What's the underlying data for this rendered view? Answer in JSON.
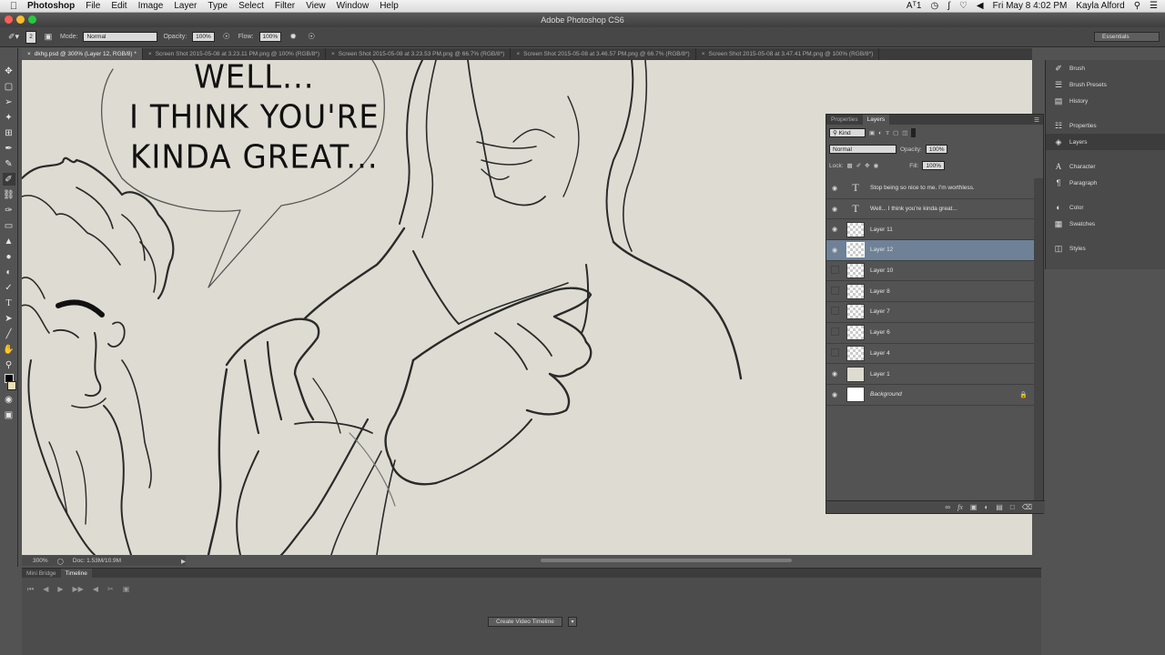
{
  "menubar": {
    "app": "Photoshop",
    "menus": [
      "File",
      "Edit",
      "Image",
      "Layer",
      "Type",
      "Select",
      "Filter",
      "View",
      "Window",
      "Help"
    ],
    "status_num": "1",
    "datetime": "Fri May 8  4:02 PM",
    "user": "Kayla Alford"
  },
  "window": {
    "title": "Adobe Photoshop CS6"
  },
  "options": {
    "brush_size": "2",
    "mode_label": "Mode:",
    "mode_value": "Normal",
    "opacity_label": "Opacity:",
    "opacity_value": "100%",
    "flow_label": "Flow:",
    "flow_value": "100%",
    "workspace": "Essentials"
  },
  "tabs": [
    {
      "label": "dkhg.psd @ 300% (Layer 12, RGB/8) *"
    },
    {
      "label": "Screen Shot 2015-05-08 at 3.23.11 PM.png @ 100% (RGB/8*)"
    },
    {
      "label": "Screen Shot 2015-05-08 at 3.23.53 PM.png @ 66.7% (RGB/8*)"
    },
    {
      "label": "Screen Shot 2015-05-08 at 3.46.57 PM.png @ 66.7% (RGB/8*)"
    },
    {
      "label": "Screen Shot 2015-05-08 at 3.47.41 PM.png @ 100% (RGB/8*)"
    }
  ],
  "canvas": {
    "speech": [
      "WELL...",
      "I THINK YOU'RE",
      "KINDA GREAT..."
    ]
  },
  "status": {
    "zoom": "300%",
    "doc": "Doc: 1.53M/10.9M"
  },
  "timeline": {
    "tabs": [
      "Mini Bridge",
      "Timeline"
    ],
    "create_button": "Create Video Timeline"
  },
  "dock": {
    "items": [
      {
        "label": "Brush",
        "icon": "brush-icon"
      },
      {
        "label": "Brush Presets",
        "icon": "brush-presets-icon"
      },
      {
        "label": "History",
        "icon": "history-icon"
      },
      {
        "label": "Properties",
        "icon": "properties-icon"
      },
      {
        "label": "Layers",
        "icon": "layers-icon"
      },
      {
        "label": "Character",
        "icon": "character-icon"
      },
      {
        "label": "Paragraph",
        "icon": "paragraph-icon"
      },
      {
        "label": "Color",
        "icon": "color-icon"
      },
      {
        "label": "Swatches",
        "icon": "swatches-icon"
      },
      {
        "label": "Styles",
        "icon": "styles-icon"
      }
    ]
  },
  "layers_panel": {
    "tabs": [
      "Properties",
      "Layers"
    ],
    "kind": "Kind",
    "blend_mode": "Normal",
    "opacity_label": "Opacity:",
    "opacity_value": "100%",
    "lock_label": "Lock:",
    "fill_label": "Fill:",
    "fill_value": "100%",
    "layers": [
      {
        "name": "Stop being so nice to me. I'm worthless.",
        "visible": true,
        "type": "text"
      },
      {
        "name": "Well... I think you're  kinda great...",
        "visible": true,
        "type": "text"
      },
      {
        "name": "Layer 11",
        "visible": true,
        "type": "pixel"
      },
      {
        "name": "Layer 12",
        "visible": true,
        "type": "pixel",
        "selected": true
      },
      {
        "name": "Layer 10",
        "visible": false,
        "type": "pixel"
      },
      {
        "name": "Layer 8",
        "visible": false,
        "type": "pixel"
      },
      {
        "name": "Layer 7",
        "visible": false,
        "type": "pixel"
      },
      {
        "name": "Layer 6",
        "visible": false,
        "type": "pixel"
      },
      {
        "name": "Layer 4",
        "visible": false,
        "type": "pixel"
      },
      {
        "name": "Layer 1",
        "visible": true,
        "type": "solid"
      },
      {
        "name": "Background",
        "visible": true,
        "type": "background",
        "locked": true
      }
    ]
  },
  "colors": {
    "selection": "#6e8196",
    "canvas": "#dedcd2",
    "panel": "#535353"
  }
}
